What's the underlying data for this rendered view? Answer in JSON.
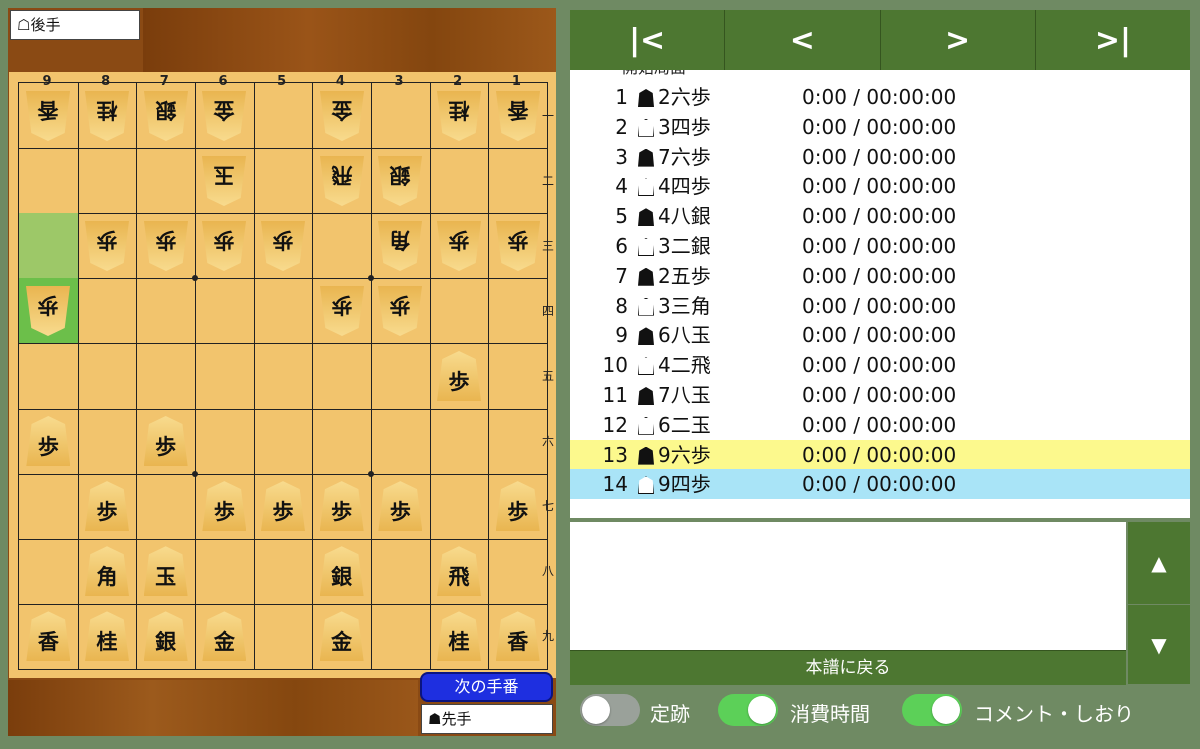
{
  "gote_label": "☖後手",
  "sente_label": "☗先手",
  "next_turn_label": "次の手番",
  "file_labels": [
    "9",
    "8",
    "7",
    "6",
    "5",
    "4",
    "3",
    "2",
    "1"
  ],
  "rank_labels": [
    "一",
    "二",
    "三",
    "四",
    "五",
    "六",
    "七",
    "八",
    "九"
  ],
  "colors": {
    "board": "#f2c46d",
    "highlight": "#9dc868",
    "highlight_strong": "#6cbf4a",
    "row_highlight": "#fcf98d",
    "row_selected": "#a9e4f7",
    "nav": "#4d7731"
  },
  "highlights": [
    {
      "file": 9,
      "rank": 3,
      "kind": "from"
    },
    {
      "file": 9,
      "rank": 4,
      "kind": "to"
    }
  ],
  "pieces": [
    {
      "file": 9,
      "rank": 1,
      "char": "香",
      "side": "gote"
    },
    {
      "file": 8,
      "rank": 1,
      "char": "桂",
      "side": "gote"
    },
    {
      "file": 7,
      "rank": 1,
      "char": "銀",
      "side": "gote"
    },
    {
      "file": 6,
      "rank": 1,
      "char": "金",
      "side": "gote"
    },
    {
      "file": 4,
      "rank": 1,
      "char": "金",
      "side": "gote"
    },
    {
      "file": 2,
      "rank": 1,
      "char": "桂",
      "side": "gote"
    },
    {
      "file": 1,
      "rank": 1,
      "char": "香",
      "side": "gote"
    },
    {
      "file": 6,
      "rank": 2,
      "char": "玉",
      "side": "gote"
    },
    {
      "file": 4,
      "rank": 2,
      "char": "飛",
      "side": "gote"
    },
    {
      "file": 3,
      "rank": 2,
      "char": "銀",
      "side": "gote"
    },
    {
      "file": 8,
      "rank": 3,
      "char": "歩",
      "side": "gote"
    },
    {
      "file": 7,
      "rank": 3,
      "char": "歩",
      "side": "gote"
    },
    {
      "file": 6,
      "rank": 3,
      "char": "歩",
      "side": "gote"
    },
    {
      "file": 5,
      "rank": 3,
      "char": "歩",
      "side": "gote"
    },
    {
      "file": 3,
      "rank": 3,
      "char": "角",
      "side": "gote"
    },
    {
      "file": 2,
      "rank": 3,
      "char": "歩",
      "side": "gote"
    },
    {
      "file": 1,
      "rank": 3,
      "char": "歩",
      "side": "gote"
    },
    {
      "file": 9,
      "rank": 4,
      "char": "歩",
      "side": "gote"
    },
    {
      "file": 4,
      "rank": 4,
      "char": "歩",
      "side": "gote"
    },
    {
      "file": 3,
      "rank": 4,
      "char": "歩",
      "side": "gote"
    },
    {
      "file": 2,
      "rank": 5,
      "char": "歩",
      "side": "sente"
    },
    {
      "file": 9,
      "rank": 6,
      "char": "歩",
      "side": "sente"
    },
    {
      "file": 7,
      "rank": 6,
      "char": "歩",
      "side": "sente"
    },
    {
      "file": 8,
      "rank": 7,
      "char": "歩",
      "side": "sente"
    },
    {
      "file": 6,
      "rank": 7,
      "char": "歩",
      "side": "sente"
    },
    {
      "file": 5,
      "rank": 7,
      "char": "歩",
      "side": "sente"
    },
    {
      "file": 4,
      "rank": 7,
      "char": "歩",
      "side": "sente"
    },
    {
      "file": 3,
      "rank": 7,
      "char": "歩",
      "side": "sente"
    },
    {
      "file": 1,
      "rank": 7,
      "char": "歩",
      "side": "sente"
    },
    {
      "file": 8,
      "rank": 8,
      "char": "角",
      "side": "sente"
    },
    {
      "file": 7,
      "rank": 8,
      "char": "玉",
      "side": "sente"
    },
    {
      "file": 4,
      "rank": 8,
      "char": "銀",
      "side": "sente"
    },
    {
      "file": 2,
      "rank": 8,
      "char": "飛",
      "side": "sente"
    },
    {
      "file": 9,
      "rank": 9,
      "char": "香",
      "side": "sente"
    },
    {
      "file": 8,
      "rank": 9,
      "char": "桂",
      "side": "sente"
    },
    {
      "file": 7,
      "rank": 9,
      "char": "銀",
      "side": "sente"
    },
    {
      "file": 6,
      "rank": 9,
      "char": "金",
      "side": "sente"
    },
    {
      "file": 4,
      "rank": 9,
      "char": "金",
      "side": "sente"
    },
    {
      "file": 2,
      "rank": 9,
      "char": "桂",
      "side": "sente"
    },
    {
      "file": 1,
      "rank": 9,
      "char": "香",
      "side": "sente"
    }
  ],
  "nav": {
    "first": "|<",
    "prev": "<",
    "next": ">",
    "last": ">|"
  },
  "movelist_header": "開始局面",
  "moves": [
    {
      "num": "1",
      "side": "sente",
      "move": "2六歩",
      "time": "0:00 / 00:00:00"
    },
    {
      "num": "2",
      "side": "gote",
      "move": "3四歩",
      "time": "0:00 / 00:00:00"
    },
    {
      "num": "3",
      "side": "sente",
      "move": "7六歩",
      "time": "0:00 / 00:00:00"
    },
    {
      "num": "4",
      "side": "gote",
      "move": "4四歩",
      "time": "0:00 / 00:00:00"
    },
    {
      "num": "5",
      "side": "sente",
      "move": "4八銀",
      "time": "0:00 / 00:00:00"
    },
    {
      "num": "6",
      "side": "gote",
      "move": "3二銀",
      "time": "0:00 / 00:00:00"
    },
    {
      "num": "7",
      "side": "sente",
      "move": "2五歩",
      "time": "0:00 / 00:00:00"
    },
    {
      "num": "8",
      "side": "gote",
      "move": "3三角",
      "time": "0:00 / 00:00:00"
    },
    {
      "num": "9",
      "side": "sente",
      "move": "6八玉",
      "time": "0:00 / 00:00:00"
    },
    {
      "num": "10",
      "side": "gote",
      "move": "4二飛",
      "time": "0:00 / 00:00:00"
    },
    {
      "num": "11",
      "side": "sente",
      "move": "7八玉",
      "time": "0:00 / 00:00:00"
    },
    {
      "num": "12",
      "side": "gote",
      "move": "6二玉",
      "time": "0:00 / 00:00:00"
    },
    {
      "num": "13",
      "side": "sente",
      "move": "9六歩",
      "time": "0:00 / 00:00:00",
      "state": "highlight"
    },
    {
      "num": "14",
      "side": "gote",
      "move": "9四歩",
      "time": "0:00 / 00:00:00",
      "state": "selected"
    }
  ],
  "back_to_main_label": "本譜に戻る",
  "toggles": [
    {
      "label": "定跡",
      "on": false
    },
    {
      "label": "消費時間",
      "on": true
    },
    {
      "label": "コメント・しおり",
      "on": true
    }
  ]
}
